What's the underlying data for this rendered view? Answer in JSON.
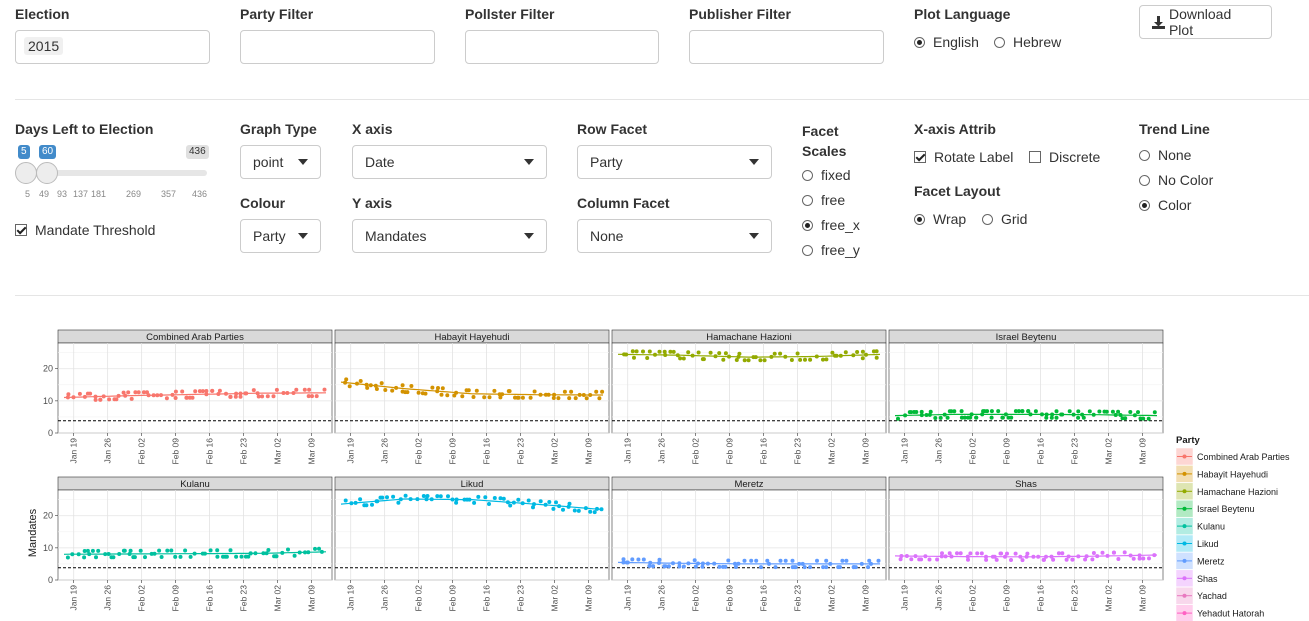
{
  "top_filters": {
    "election": {
      "label": "Election",
      "value": "2015"
    },
    "party": {
      "label": "Party Filter",
      "value": ""
    },
    "pollster": {
      "label": "Pollster Filter",
      "value": ""
    },
    "publisher": {
      "label": "Publisher Filter",
      "value": ""
    },
    "plot_language": {
      "label": "Plot Language",
      "options": [
        "English",
        "Hebrew"
      ],
      "selected": "English"
    },
    "download_label": "Download Plot"
  },
  "controls": {
    "days_left": {
      "label": "Days Left to Election",
      "min": 5,
      "max": 436,
      "low": 5,
      "high": 60,
      "low_label": "5",
      "high_label": "60",
      "max_label": "436",
      "ticks": [
        "5",
        "49",
        "93",
        "137",
        "181",
        "269",
        "357",
        "436"
      ]
    },
    "mandate_threshold": {
      "label": "Mandate Threshold",
      "checked": true
    },
    "graph_type": {
      "label": "Graph Type",
      "value": "point"
    },
    "colour": {
      "label": "Colour",
      "value": "Party"
    },
    "x_axis": {
      "label": "X axis",
      "value": "Date"
    },
    "y_axis": {
      "label": "Y axis",
      "value": "Mandates"
    },
    "row_facet": {
      "label": "Row Facet",
      "value": "Party"
    },
    "column_facet": {
      "label": "Column Facet",
      "value": "None"
    },
    "facet_scales": {
      "label_1": "Facet",
      "label_2": "Scales",
      "options": [
        "fixed",
        "free",
        "free_x",
        "free_y"
      ],
      "selected": "free_x"
    },
    "x_axis_attrib": {
      "label": "X-axis Attrib",
      "rotate_label": "Rotate Label",
      "rotate_checked": true,
      "discrete_label": "Discrete",
      "discrete_checked": false
    },
    "facet_layout": {
      "label": "Facet Layout",
      "options": [
        "Wrap",
        "Grid"
      ],
      "selected": "Wrap"
    },
    "trend_line": {
      "label": "Trend Line",
      "options": [
        "None",
        "No Color",
        "Color"
      ],
      "selected": "Color"
    }
  },
  "chart_data": {
    "type": "scatter",
    "ylabel": "Mandates",
    "x_ticks": [
      "Jan 19",
      "Jan 26",
      "Feb 02",
      "Feb 09",
      "Feb 16",
      "Feb 23",
      "Mar 02",
      "Mar 09"
    ],
    "y_ticks": [
      0,
      10,
      20
    ],
    "ylim": [
      0,
      28
    ],
    "threshold": 3.8,
    "legend_title": "Party",
    "legend_position": "right",
    "series": [
      {
        "name": "Combined Arab Parties",
        "color": "#F8766D",
        "dates": [
          "2015-01-16",
          "2015-01-30",
          "2015-02-13",
          "2015-02-27",
          "2015-03-13"
        ],
        "trend": [
          11,
          11.6,
          12,
          12.4,
          12.5
        ]
      },
      {
        "name": "Habayit Hayehudi",
        "color": "#D39200",
        "dates": [
          "2015-01-16",
          "2015-01-30",
          "2015-02-13",
          "2015-02-27",
          "2015-03-13"
        ],
        "trend": [
          16,
          13.8,
          12.2,
          11.9,
          11.8
        ]
      },
      {
        "name": "Hamachane Hazioni",
        "color": "#93AA00",
        "dates": [
          "2015-01-16",
          "2015-01-30",
          "2015-02-13",
          "2015-02-27",
          "2015-03-13"
        ],
        "trend": [
          24.5,
          24.2,
          23.6,
          23.8,
          24.5
        ]
      },
      {
        "name": "Israel Beytenu",
        "color": "#00BA38",
        "dates": [
          "2015-01-16",
          "2015-01-30",
          "2015-02-13",
          "2015-02-27",
          "2015-03-13"
        ],
        "trend": [
          5.4,
          5.8,
          5.8,
          5.7,
          5.4
        ]
      },
      {
        "name": "Kulanu",
        "color": "#00C19F",
        "dates": [
          "2015-01-16",
          "2015-01-30",
          "2015-02-13",
          "2015-02-27",
          "2015-03-13"
        ],
        "trend": [
          8,
          8.1,
          8.2,
          8.3,
          8.8
        ]
      },
      {
        "name": "Likud",
        "color": "#00B9E3",
        "dates": [
          "2015-01-16",
          "2015-01-30",
          "2015-02-13",
          "2015-02-27",
          "2015-03-13"
        ],
        "trend": [
          23.5,
          25.2,
          25,
          23.5,
          21.8
        ]
      },
      {
        "name": "Meretz",
        "color": "#619CFF",
        "dates": [
          "2015-01-16",
          "2015-01-30",
          "2015-02-13",
          "2015-02-27",
          "2015-03-13"
        ],
        "trend": [
          5.5,
          5.2,
          5,
          5,
          5
        ]
      },
      {
        "name": "Shas",
        "color": "#DB72FB",
        "dates": [
          "2015-01-16",
          "2015-01-30",
          "2015-02-13",
          "2015-02-27",
          "2015-03-13"
        ],
        "trend": [
          7.5,
          7.3,
          7.2,
          7.4,
          7.8
        ]
      },
      {
        "name": "Yachad",
        "color": "#E879C0",
        "dates": [],
        "trend": []
      },
      {
        "name": "Yehadut Hatorah",
        "color": "#FF61C3",
        "dates": [],
        "trend": []
      }
    ]
  }
}
